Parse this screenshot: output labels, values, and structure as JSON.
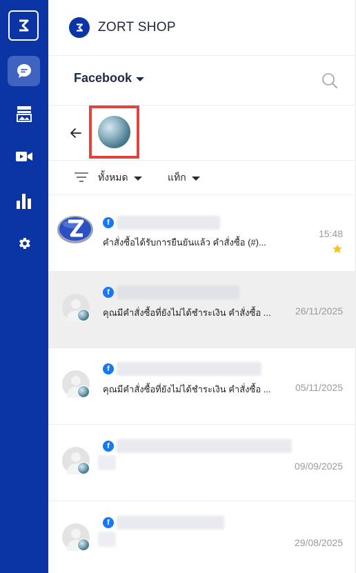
{
  "app": {
    "shop_name": "ZORT SHOP",
    "accent": "#0b35a4",
    "highlight": "#e0453d"
  },
  "rail": {
    "items": [
      {
        "icon": "zort-logo-icon"
      },
      {
        "icon": "chat-icon",
        "active": true
      },
      {
        "icon": "gallery-icon"
      },
      {
        "icon": "video-icon"
      },
      {
        "icon": "bar-chart-icon"
      },
      {
        "icon": "gear-icon"
      }
    ]
  },
  "header": {
    "channel": "Facebook"
  },
  "filters": {
    "all_label": "ทั้งหมด",
    "tag_label": "แท็ก"
  },
  "conversations": [
    {
      "preview": "คำสั่งซื้อได้รับการยืนยันแล้ว คำสั่งซื้อ (#)...",
      "time": "15:48",
      "starred": true
    },
    {
      "preview": "คุณมีคำสั่งซื้อที่ยังไม่ได้ชำระเงิน คำสั่งซื้อ ...",
      "time": "26/11/2025",
      "selected": true
    },
    {
      "preview": "คุณมีคำสั่งซื้อที่ยังไม่ได้ชำระเงิน คำสั่งซื้อ ...",
      "time": "05/11/2025"
    },
    {
      "preview": "",
      "time": "09/09/2025"
    },
    {
      "preview": "",
      "time": "29/08/2025"
    }
  ]
}
